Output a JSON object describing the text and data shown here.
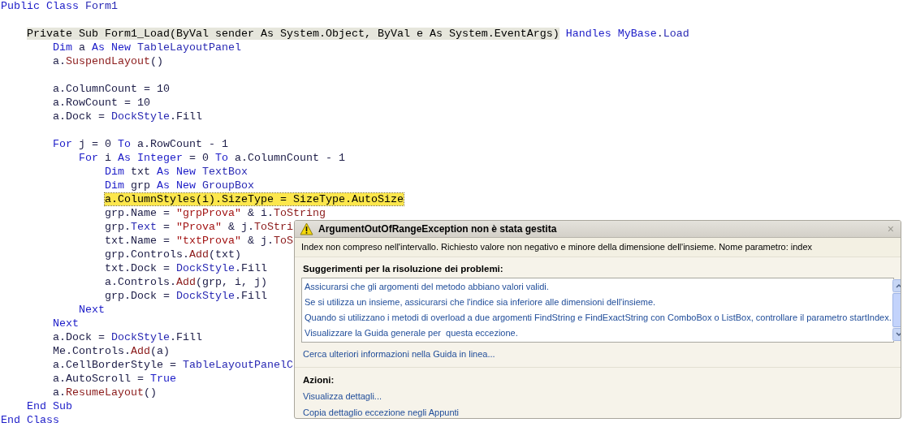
{
  "code_lines": [
    {
      "kind": "code",
      "tokens": [
        {
          "kind": "kw",
          "text": "Public Class"
        },
        {
          "kind": "type",
          "text": "Form1"
        }
      ],
      "children": [
        {
          "kind": "blank"
        },
        {
          "kind": "code",
          "tokens": [
            {
              "kind": "statement",
              "text": "Private Sub Form1_Load(ByVal sender As System.Object, ByVal e As System.EventArgs)"
            },
            {
              "kind": "kw",
              "text": "Handles MyBase"
            },
            {
              "kind": "plain",
              "text": "."
            },
            {
              "kind": "type",
              "text": "Load"
            }
          ],
          "children": [
            {
              "kind": "code",
              "tokens": [
                {
                  "kind": "kw",
                  "text": "Dim"
                },
                {
                  "kind": "plain",
                  "text": "a"
                },
                {
                  "kind": "kw",
                  "text": "As New"
                },
                {
                  "kind": "type",
                  "text": "TableLayoutPanel"
                }
              ]
            },
            {
              "kind": "code",
              "tokens": [
                {
                  "kind": "plain",
                  "text": "a."
                },
                {
                  "kind": "method",
                  "text": "SuspendLayout"
                },
                {
                  "kind": "plain",
                  "text": "()"
                }
              ]
            },
            {
              "kind": "blank"
            },
            {
              "kind": "code",
              "tokens": [
                {
                  "kind": "plain",
                  "text": "a.ColumnCount = 10"
                }
              ]
            },
            {
              "kind": "code",
              "tokens": [
                {
                  "kind": "plain",
                  "text": "a.RowCount = 10"
                }
              ]
            },
            {
              "kind": "code",
              "tokens": [
                {
                  "kind": "plain",
                  "text": "a.Dock ="
                },
                {
                  "kind": "type",
                  "text": "DockStyle"
                },
                {
                  "kind": "plain",
                  "text": ".Fill"
                }
              ]
            },
            {
              "kind": "blank"
            },
            {
              "kind": "code",
              "tokens": [
                {
                  "kind": "kw",
                  "text": "For"
                },
                {
                  "kind": "plain",
                  "text": "j = 0"
                },
                {
                  "kind": "kw",
                  "text": "To"
                },
                {
                  "kind": "plain",
                  "text": "a.RowCount - 1"
                }
              ],
              "children": [
                {
                  "kind": "code",
                  "tokens": [
                    {
                      "kind": "kw",
                      "text": "For"
                    },
                    {
                      "kind": "plain",
                      "text": "i"
                    },
                    {
                      "kind": "kw",
                      "text": "As Integer"
                    },
                    {
                      "kind": "plain",
                      "text": "= 0"
                    },
                    {
                      "kind": "kw",
                      "text": "To"
                    },
                    {
                      "kind": "plain",
                      "text": "a.ColumnCount - 1"
                    }
                  ],
                  "children": [
                    {
                      "kind": "code",
                      "tokens": [
                        {
                          "kind": "kw",
                          "text": "Dim"
                        },
                        {
                          "kind": "plain",
                          "text": "txt"
                        },
                        {
                          "kind": "kw",
                          "text": "As New"
                        },
                        {
                          "kind": "type",
                          "text": "TextBox"
                        }
                      ]
                    },
                    {
                      "kind": "code",
                      "tokens": [
                        {
                          "kind": "kw",
                          "text": "Dim"
                        },
                        {
                          "kind": "plain",
                          "text": "grp"
                        },
                        {
                          "kind": "kw",
                          "text": "As New"
                        },
                        {
                          "kind": "type",
                          "text": "GroupBox"
                        }
                      ]
                    },
                    {
                      "kind": "code",
                      "tokens": [
                        {
                          "kind": "current",
                          "text": "a.ColumnStyles(i).SizeType = SizeType.AutoSize"
                        }
                      ]
                    },
                    {
                      "kind": "code",
                      "tokens": [
                        {
                          "kind": "plain",
                          "text": "grp.Name ="
                        },
                        {
                          "kind": "string",
                          "text": "\"grpProva\""
                        },
                        {
                          "kind": "plain",
                          "text": "& i."
                        },
                        {
                          "kind": "method",
                          "text": "ToString"
                        }
                      ]
                    },
                    {
                      "kind": "code",
                      "tokens": [
                        {
                          "kind": "plain",
                          "text": "grp."
                        },
                        {
                          "kind": "type",
                          "text": "Text"
                        },
                        {
                          "kind": "plain",
                          "text": "="
                        },
                        {
                          "kind": "string",
                          "text": "\"Prova\""
                        },
                        {
                          "kind": "plain",
                          "text": "& j."
                        },
                        {
                          "kind": "method",
                          "text": "ToStri"
                        }
                      ]
                    },
                    {
                      "kind": "code",
                      "tokens": [
                        {
                          "kind": "plain",
                          "text": "txt.Name ="
                        },
                        {
                          "kind": "string",
                          "text": "\"txtProva\""
                        },
                        {
                          "kind": "plain",
                          "text": "& j."
                        },
                        {
                          "kind": "method",
                          "text": "ToS"
                        }
                      ]
                    },
                    {
                      "kind": "code",
                      "tokens": [
                        {
                          "kind": "plain",
                          "text": "grp.Controls."
                        },
                        {
                          "kind": "method",
                          "text": "Add"
                        },
                        {
                          "kind": "plain",
                          "text": "(txt)"
                        }
                      ]
                    },
                    {
                      "kind": "code",
                      "tokens": [
                        {
                          "kind": "plain",
                          "text": "txt.Dock ="
                        },
                        {
                          "kind": "type",
                          "text": "DockStyle"
                        },
                        {
                          "kind": "plain",
                          "text": ".Fill"
                        }
                      ]
                    },
                    {
                      "kind": "code",
                      "tokens": [
                        {
                          "kind": "plain",
                          "text": "a.Controls."
                        },
                        {
                          "kind": "method",
                          "text": "Add"
                        },
                        {
                          "kind": "plain",
                          "text": "(grp, i, j)"
                        }
                      ]
                    },
                    {
                      "kind": "code",
                      "tokens": [
                        {
                          "kind": "plain",
                          "text": "grp.Dock ="
                        },
                        {
                          "kind": "type",
                          "text": "DockStyle"
                        },
                        {
                          "kind": "plain",
                          "text": ".Fill"
                        }
                      ]
                    }
                  ]
                },
                {
                  "kind": "code",
                  "tokens": [
                    {
                      "kind": "kw",
                      "text": "Next"
                    }
                  ]
                }
              ]
            },
            {
              "kind": "code",
              "tokens": [
                {
                  "kind": "kw",
                  "text": "Next"
                }
              ]
            },
            {
              "kind": "code",
              "tokens": [
                {
                  "kind": "plain",
                  "text": "a.Dock ="
                },
                {
                  "kind": "type",
                  "text": "DockStyle"
                },
                {
                  "kind": "plain",
                  "text": ".Fill"
                }
              ]
            },
            {
              "kind": "code",
              "tokens": [
                {
                  "kind": "plain",
                  "text": "Me.Controls."
                },
                {
                  "kind": "method",
                  "text": "Add"
                },
                {
                  "kind": "plain",
                  "text": "(a)"
                }
              ]
            },
            {
              "kind": "code",
              "tokens": [
                {
                  "kind": "plain",
                  "text": "a.CellBorderStyle ="
                },
                {
                  "kind": "type",
                  "text": "TableLayoutPanelC"
                }
              ]
            },
            {
              "kind": "code",
              "tokens": [
                {
                  "kind": "plain",
                  "text": "a.AutoScroll ="
                },
                {
                  "kind": "kw",
                  "text": "True"
                }
              ]
            },
            {
              "kind": "code",
              "tokens": [
                {
                  "kind": "plain",
                  "text": "a."
                },
                {
                  "kind": "method",
                  "text": "ResumeLayout"
                },
                {
                  "kind": "plain",
                  "text": "()"
                }
              ]
            }
          ]
        },
        {
          "kind": "code",
          "tokens": [
            {
              "kind": "kw",
              "text": "End Sub"
            }
          ]
        }
      ]
    },
    {
      "kind": "code",
      "tokens": [
        {
          "kind": "kw",
          "text": "End Class"
        }
      ]
    }
  ],
  "exception_dialog": {
    "title": "ArgumentOutOfRangeException non è stata gestita",
    "close": "×",
    "message": "Index non compreso nell'intervallo. Richiesto valore non negativo e minore della dimensione dell'insieme. Nome parametro: index",
    "troubleshooting": {
      "heading": "Suggerimenti per la risoluzione dei problemi:",
      "items": [
        "Assicurarsi che gli argomenti del metodo abbiano valori validi.",
        "Se si utilizza un insieme, assicurarsi che l'indice sia inferiore alle dimensioni dell'insieme.",
        "Quando si utilizzano i metodi di overload a due argomenti FindString e FindExactString con ComboBox o ListBox, controllare il parametro startIndex.",
        "Visualizzare la Guida generale per  questa eccezione."
      ]
    },
    "help_link": "Cerca ulteriori informazioni nella Guida in linea...",
    "actions": {
      "heading": "Azioni:",
      "items": [
        "Visualizza dettagli...",
        "Copia dettaglio eccezione negli Appunti"
      ]
    }
  }
}
